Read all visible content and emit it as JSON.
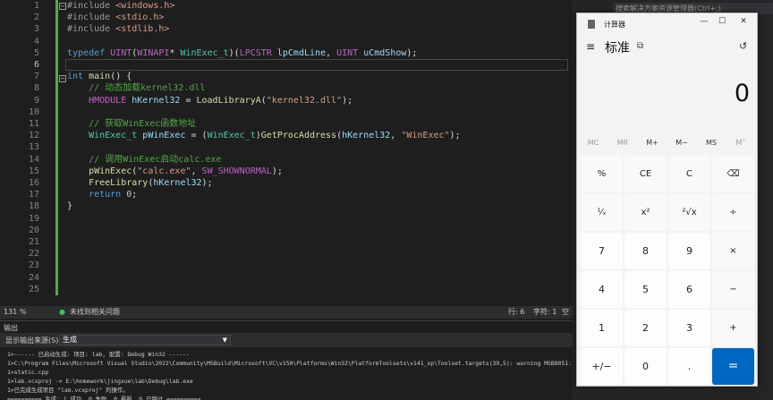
{
  "editor": {
    "lines": [
      {
        "n": "1",
        "parts": [
          [
            "pp",
            "#include "
          ],
          [
            "inc",
            "<windows.h>"
          ]
        ]
      },
      {
        "n": "2",
        "parts": [
          [
            "pp",
            "#include "
          ],
          [
            "inc",
            "<stdio.h>"
          ]
        ]
      },
      {
        "n": "3",
        "parts": [
          [
            "pp",
            "#include "
          ],
          [
            "inc",
            "<stdlib.h>"
          ]
        ]
      },
      {
        "n": "4",
        "parts": []
      },
      {
        "n": "5",
        "parts": [
          [
            "kw",
            "typedef "
          ],
          [
            "mac",
            "UINT"
          ],
          [
            "",
            "("
          ],
          [
            "mac",
            "WINAPI"
          ],
          [
            "",
            "* "
          ],
          [
            "typ",
            "WinExec_t"
          ],
          [
            "",
            ")("
          ],
          [
            "mac",
            "LPCSTR"
          ],
          [
            "",
            " "
          ],
          [
            "var",
            "lpCmdLine"
          ],
          [
            "",
            ", "
          ],
          [
            "mac",
            "UINT"
          ],
          [
            "",
            " "
          ],
          [
            "var",
            "uCmdShow"
          ],
          [
            "",
            ");"
          ]
        ]
      },
      {
        "n": "6",
        "parts": []
      },
      {
        "n": "7",
        "parts": [
          [
            "kw",
            "int "
          ],
          [
            "fn",
            "main"
          ],
          [
            "",
            "() {"
          ]
        ]
      },
      {
        "n": "8",
        "parts": [
          [
            "cm",
            "    // 动态加载kernel32.dll"
          ]
        ]
      },
      {
        "n": "9",
        "parts": [
          [
            "mac",
            "    HMODULE "
          ],
          [
            "var",
            "hKernel32"
          ],
          [
            "",
            " = "
          ],
          [
            "fn",
            "LoadLibraryA"
          ],
          [
            "",
            "("
          ],
          [
            "str",
            "\"kernel32.dll\""
          ],
          [
            "",
            ");"
          ]
        ]
      },
      {
        "n": "10",
        "parts": []
      },
      {
        "n": "11",
        "parts": [
          [
            "cm",
            "    // 获取WinExec函数地址"
          ]
        ]
      },
      {
        "n": "12",
        "parts": [
          [
            "typ",
            "    WinExec_t "
          ],
          [
            "var",
            "pWinExec"
          ],
          [
            "",
            " = ("
          ],
          [
            "typ",
            "WinExec_t"
          ],
          [
            "",
            ")"
          ],
          [
            "fn",
            "GetProcAddress"
          ],
          [
            "",
            "("
          ],
          [
            "var",
            "hKernel32"
          ],
          [
            "",
            ", "
          ],
          [
            "str",
            "\"WinExec\""
          ],
          [
            "",
            ");"
          ]
        ]
      },
      {
        "n": "13",
        "parts": []
      },
      {
        "n": "14",
        "parts": [
          [
            "cm",
            "    // 调用WinExec启动calc.exe"
          ]
        ]
      },
      {
        "n": "15",
        "parts": [
          [
            "fn",
            "    pWinExec"
          ],
          [
            "",
            "("
          ],
          [
            "str",
            "\"calc.exe\""
          ],
          [
            "",
            ", "
          ],
          [
            "mac",
            "SW_SHOWNORMAL"
          ],
          [
            "",
            ");"
          ]
        ]
      },
      {
        "n": "16",
        "parts": [
          [
            "fn",
            "    FreeLibrary"
          ],
          [
            "",
            "("
          ],
          [
            "var",
            "hKernel32"
          ],
          [
            "",
            ");"
          ]
        ]
      },
      {
        "n": "17",
        "parts": [
          [
            "kw",
            "    return "
          ],
          [
            "num",
            "0"
          ],
          [
            "",
            ";"
          ]
        ]
      },
      {
        "n": "18",
        "parts": [
          [
            "",
            "}"
          ]
        ]
      },
      {
        "n": "19",
        "parts": []
      },
      {
        "n": "20",
        "parts": []
      },
      {
        "n": "21",
        "parts": []
      },
      {
        "n": "22",
        "parts": []
      },
      {
        "n": "23",
        "parts": []
      },
      {
        "n": "24",
        "parts": []
      },
      {
        "n": "25",
        "parts": []
      }
    ]
  },
  "status": {
    "zoom": "131 %",
    "issues": "未找到相关问题",
    "row": "行: 6",
    "col": "字符: 1",
    "spaces": "空格"
  },
  "output": {
    "title": "输出",
    "source_label": "显示输出来源(S):",
    "source_value": "生成",
    "lines": [
      "1>------ 已启动生成: 项目: lab, 配置: Debug Win32 ------",
      "1>C:\\Program Files\\Microsoft Visual Studio\\2022\\Community\\MSBuild\\Microsoft\\VC\\v150\\Platforms\\Win32\\PlatformToolsets\\v141_xp\\Toolset.targets(39,5): warning MSB8051: 面向",
      "1>static.cpp",
      "1>lab.vcxproj -> E:\\homework\\jingxue\\lab\\Debug\\lab.exe",
      "1>已完成生成项目 \"lab.vcxproj\" 的操作。",
      "========== 生成: 1 成功, 0 失败, 0 最新, 0 已跳过 =========="
    ]
  },
  "right_search": "搜索解决方案资源管理器(Ctrl+;)",
  "calculator": {
    "title": "计算器",
    "menu_icon": "≡",
    "mode": "标准",
    "keep_on_top_icon": "⧉",
    "history_icon": "↺",
    "minimize": "—",
    "maximize": "☐",
    "close": "✕",
    "display": "0",
    "memory": [
      "MC",
      "MR",
      "M+",
      "M−",
      "MS",
      "M˅"
    ],
    "keys": [
      [
        "%",
        "CE",
        "C",
        "⌫"
      ],
      [
        "¹⁄ₓ",
        "x²",
        "²√x",
        "÷"
      ],
      [
        "7",
        "8",
        "9",
        "×"
      ],
      [
        "4",
        "5",
        "6",
        "−"
      ],
      [
        "1",
        "2",
        "3",
        "+"
      ],
      [
        "+/−",
        "0",
        ".",
        "="
      ]
    ]
  }
}
